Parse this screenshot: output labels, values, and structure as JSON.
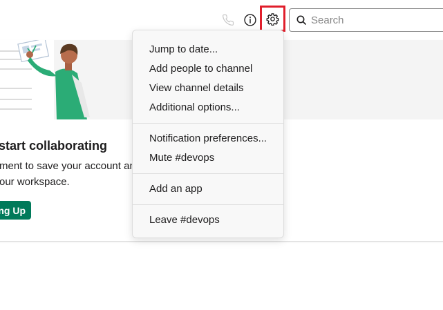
{
  "header": {
    "search": {
      "placeholder": "Search",
      "value": ""
    },
    "icons": [
      "phone-icon",
      "info-icon",
      "gear-icon",
      "search-icon"
    ]
  },
  "banner": {
    "headline": "start collaborating",
    "body_line1": "ment to save your account an",
    "body_line2": "our workspace.",
    "cta_label": "ng Up",
    "cta_color": "#007a5a"
  },
  "menu": {
    "groups": [
      {
        "items": [
          "Jump to date...",
          "Add people to channel",
          "View channel details",
          "Additional options..."
        ]
      },
      {
        "items": [
          "Notification preferences...",
          "Mute #devops"
        ]
      },
      {
        "items": [
          "Add an app"
        ]
      },
      {
        "items": [
          "Leave #devops"
        ]
      }
    ]
  },
  "colors": {
    "highlight": "#e01e2b",
    "text": "#1d1c1d",
    "menu_bg": "#f8f8f8",
    "divider": "#dddddd"
  }
}
